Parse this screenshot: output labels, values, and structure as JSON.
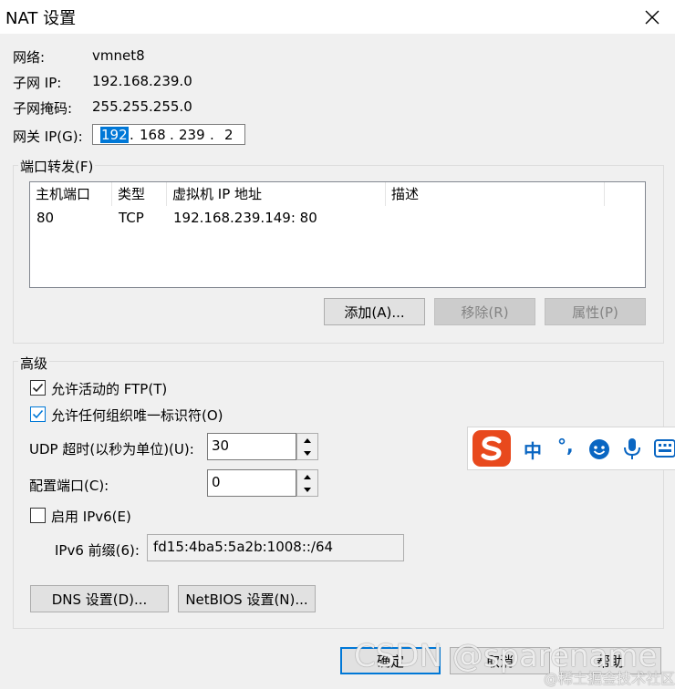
{
  "window": {
    "title": "NAT 设置"
  },
  "info": {
    "network_label": "网络:",
    "network_value": "vmnet8",
    "subnet_ip_label": "子网 IP:",
    "subnet_ip_value": "192.168.239.0",
    "mask_label": "子网掩码:",
    "mask_value": "255.255.255.0",
    "gateway_label": "网关 IP(G):",
    "gateway_octets": [
      "192",
      "168",
      "239",
      "2"
    ]
  },
  "port_forwarding": {
    "group_title": "端口转发(F)",
    "columns": [
      "主机端口",
      "类型",
      "虚拟机 IP 地址",
      "描述"
    ],
    "rows": [
      {
        "host_port": "80",
        "type": "TCP",
        "vm_addr": "192.168.239.149: 80",
        "desc": ""
      }
    ],
    "add_label": "添加(A)...",
    "remove_label": "移除(R)",
    "props_label": "属性(P)"
  },
  "advanced": {
    "group_title": "高级",
    "allow_ftp_label": "允许活动的 FTP(T)",
    "allow_ftp_checked": true,
    "allow_any_label": "允许任何组织唯一标识符(O)",
    "allow_any_checked": true,
    "udp_label": "UDP 超时(以秒为单位)(U):",
    "udp_value": "30",
    "config_port_label": "配置端口(C):",
    "config_port_value": "0",
    "ipv6_label": "启用 IPv6(E)",
    "ipv6_checked": false,
    "ipv6_prefix_label": "IPv6 前缀(6):",
    "ipv6_prefix_value": "fd15:4ba5:5a2b:1008::/64",
    "dns_label": "DNS 设置(D)...",
    "netbios_label": "NetBIOS 设置(N)..."
  },
  "footer": {
    "ok_label": "确定",
    "cancel_label": "取消",
    "help_label": "帮助"
  },
  "ime_toolbar": {
    "mode_label": "中",
    "punct_label": "°,",
    "accent": "#e8491d",
    "icon_color": "#0a66c2"
  },
  "watermark": {
    "csdn": "CSDN @sparename",
    "juejin": "@稀土掘金技术社区"
  }
}
